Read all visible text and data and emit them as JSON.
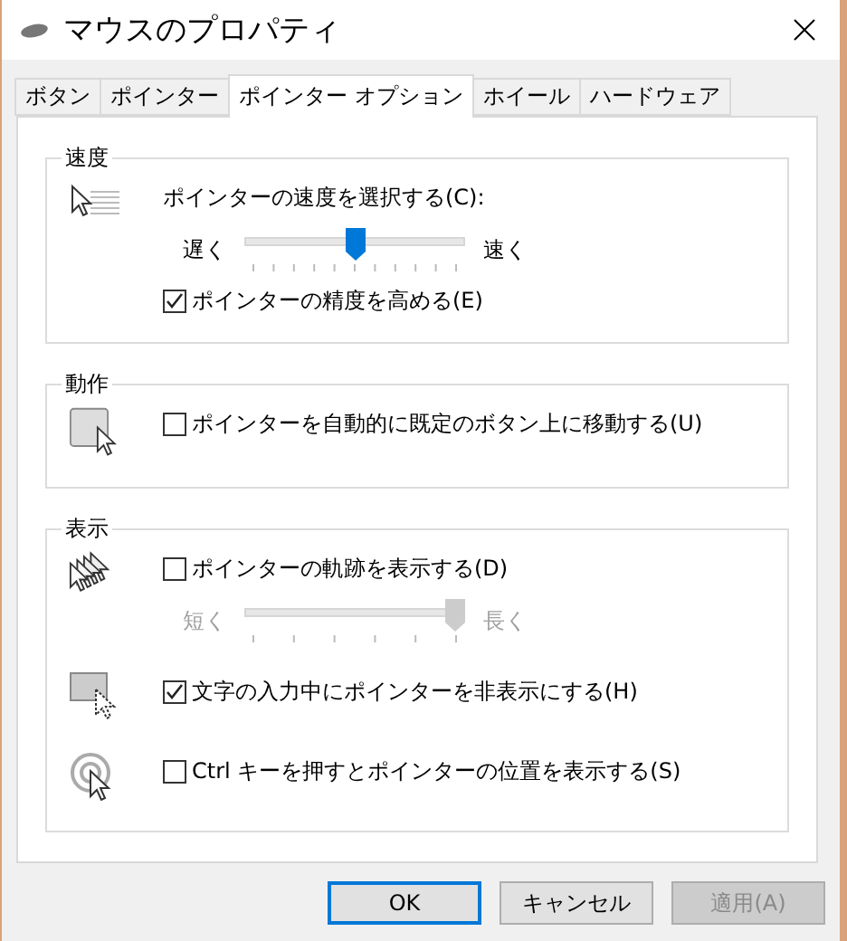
{
  "window": {
    "title": "マウスのプロパティ"
  },
  "tabs": [
    {
      "label": "ボタン",
      "selected": false
    },
    {
      "label": "ポインター",
      "selected": false
    },
    {
      "label": "ポインター オプション",
      "selected": true
    },
    {
      "label": "ホイール",
      "selected": false
    },
    {
      "label": "ハードウェア",
      "selected": false
    }
  ],
  "groups": [
    {
      "title": "速度",
      "sections": [
        {
          "items": [
            {
              "kind": "label",
              "text": "ポインターの速度を選択する(C):"
            },
            {
              "kind": "slider",
              "min_label": "遅く",
              "max_label": "速く",
              "level": 0.5,
              "disabled": false
            },
            {
              "kind": "checkbox",
              "text": "ポインターの精度を高める(E)",
              "checked": true
            }
          ]
        }
      ]
    },
    {
      "title": "動作",
      "sections": [
        {
          "items": [
            {
              "kind": "checkbox",
              "text": "ポインターを自動的に既定のボタン上に移動する(U)",
              "checked": false
            }
          ]
        }
      ]
    },
    {
      "title": "表示",
      "sections": [
        {
          "items": [
            {
              "kind": "checkbox",
              "text": "ポインターの軌跡を表示する(D)",
              "checked": false
            },
            {
              "kind": "slider",
              "min_label": "短く",
              "max_label": "長く",
              "level": 1,
              "disabled": true
            }
          ]
        },
        {
          "items": [
            {
              "kind": "checkbox",
              "text": "文字の入力中にポインターを非表示にする(H)",
              "checked": true
            }
          ]
        },
        {
          "items": [
            {
              "kind": "checkbox",
              "text": "Ctrl キーを押すとポインターの位置を表示する(S)",
              "checked": false
            }
          ]
        }
      ]
    }
  ],
  "buttons": [
    {
      "label": "OK",
      "default": true,
      "disabled": false
    },
    {
      "label": "キャンセル",
      "default": false,
      "disabled": false
    },
    {
      "label": "適用(A)",
      "default": false,
      "disabled": true
    }
  ]
}
